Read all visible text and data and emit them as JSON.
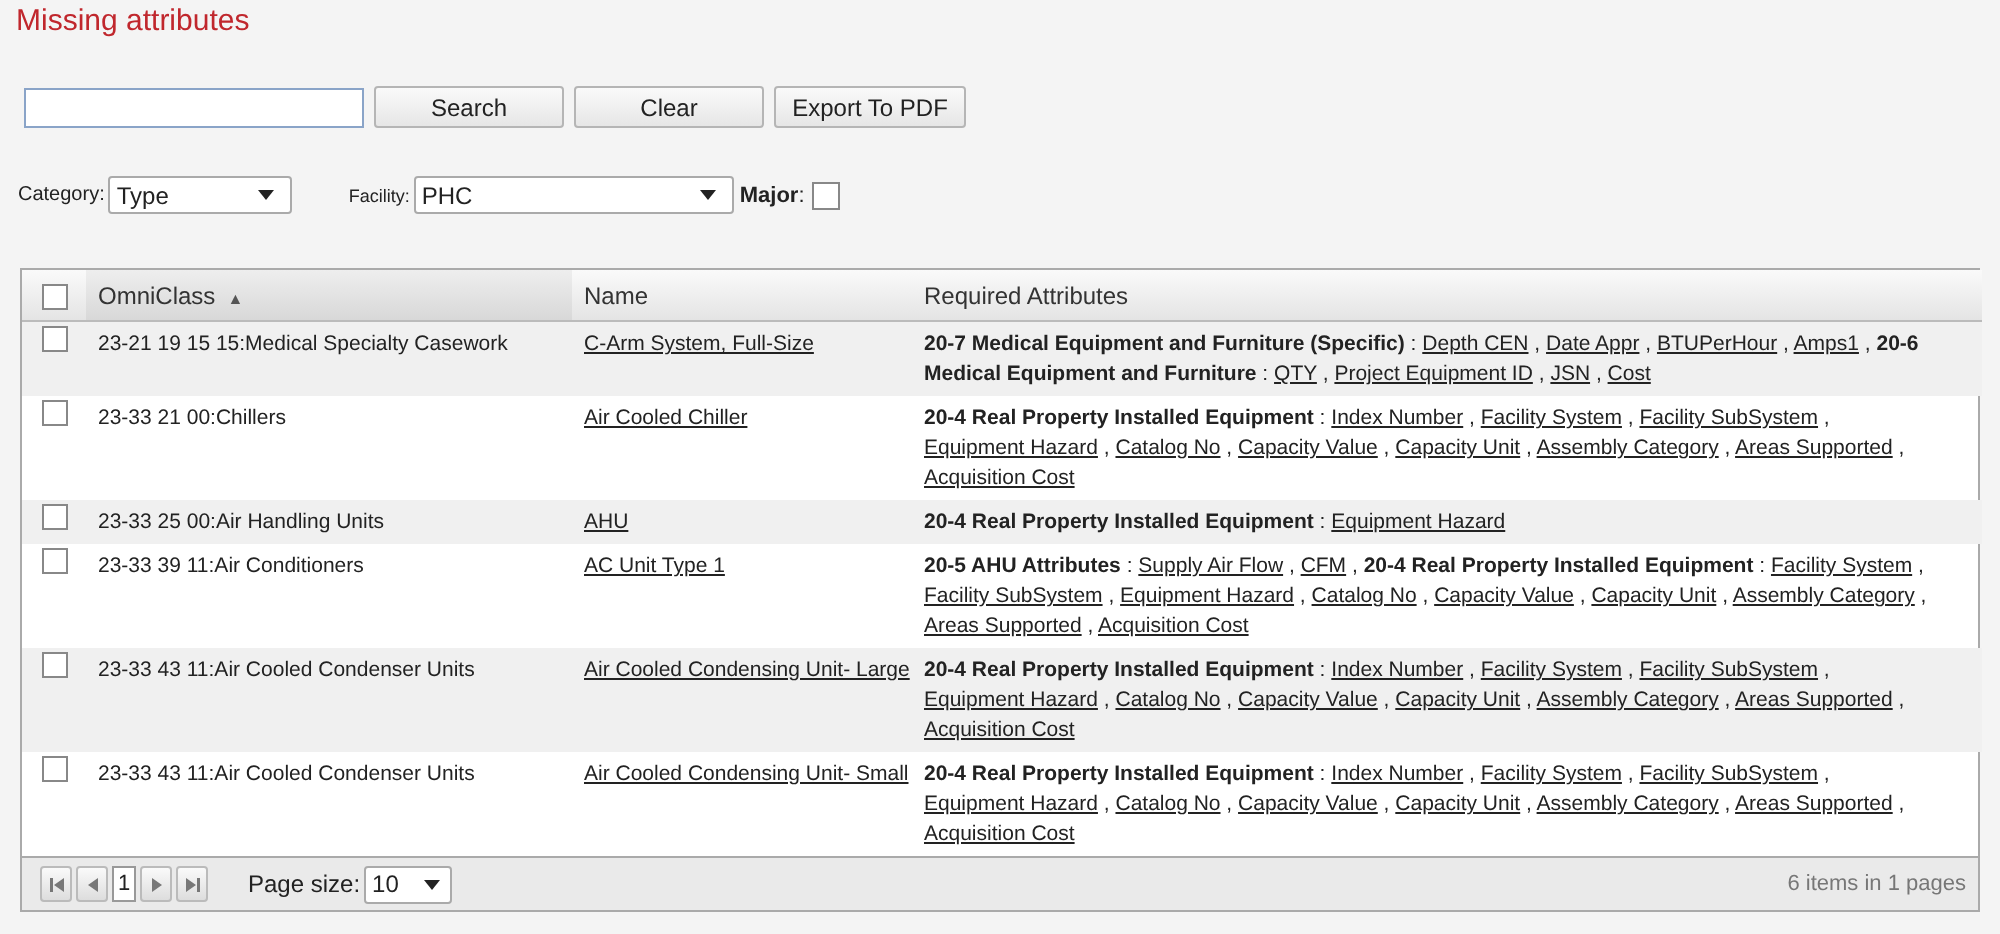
{
  "title": "Missing attributes",
  "buttons": [
    "Search",
    "Clear",
    "Export To PDF"
  ],
  "filters": {
    "category": {
      "label": "Category:",
      "value": "Type"
    },
    "facility": {
      "label": "Facility:",
      "value": "PHC"
    },
    "major": {
      "label": "Major",
      "colon": ":",
      "checked": false
    }
  },
  "table": {
    "header_checked": false,
    "group_colon": ":",
    "separator": ",",
    "columns": [
      {
        "label": "OmniClass",
        "sort": "▲"
      },
      {
        "label": "Name"
      },
      {
        "label": "Required Attributes"
      }
    ],
    "rows": [
      {
        "checked": false,
        "omniclass": "23-21 19 15 15:Medical Specialty Casework",
        "name": "C-Arm System, Full-Size",
        "attributes": [
          {
            "group": "20-7 Medical Equipment and Furniture (Specific)",
            "items": [
              "Depth CEN",
              "Date Appr",
              "BTUPerHour",
              "Amps1"
            ]
          },
          {
            "group": "20-6 Medical Equipment and Furniture",
            "items": [
              "QTY",
              "Project Equipment ID",
              "JSN",
              "Cost"
            ]
          }
        ]
      },
      {
        "checked": false,
        "omniclass": "23-33 21 00:Chillers",
        "name": "Air Cooled Chiller",
        "attributes": [
          {
            "group": "20-4 Real Property Installed Equipment",
            "items": [
              "Index Number",
              "Facility System",
              "Facility SubSystem",
              "Equipment Hazard",
              "Catalog No",
              "Capacity Value",
              "Capacity Unit",
              "Assembly Category",
              "Areas Supported",
              "Acquisition Cost"
            ]
          }
        ]
      },
      {
        "checked": false,
        "omniclass": "23-33 25 00:Air Handling Units",
        "name": "AHU",
        "attributes": [
          {
            "group": "20-4 Real Property Installed Equipment",
            "items": [
              "Equipment Hazard"
            ]
          }
        ]
      },
      {
        "checked": false,
        "omniclass": "23-33 39 11:Air Conditioners",
        "name": "AC Unit Type 1",
        "attributes": [
          {
            "group": "20-5 AHU Attributes",
            "items": [
              "Supply Air Flow",
              "CFM"
            ]
          },
          {
            "group": "20-4 Real Property Installed Equipment",
            "items": [
              "Facility System",
              "Facility SubSystem",
              "Equipment Hazard",
              "Catalog No",
              "Capacity Value",
              "Capacity Unit",
              "Assembly Category",
              "Areas Supported",
              "Acquisition Cost"
            ]
          }
        ]
      },
      {
        "checked": false,
        "omniclass": "23-33 43 11:Air Cooled Condenser Units",
        "name": "Air Cooled Condensing Unit- Large",
        "attributes": [
          {
            "group": "20-4 Real Property Installed Equipment",
            "items": [
              "Index Number",
              "Facility System",
              "Facility SubSystem",
              "Equipment Hazard",
              "Catalog No",
              "Capacity Value",
              "Capacity Unit",
              "Assembly Category",
              "Areas Supported",
              "Acquisition Cost"
            ]
          }
        ]
      },
      {
        "checked": false,
        "omniclass": "23-33 43 11:Air Cooled Condenser Units",
        "name": "Air Cooled Condensing Unit- Small",
        "attributes": [
          {
            "group": "20-4 Real Property Installed Equipment",
            "items": [
              "Index Number",
              "Facility System",
              "Facility SubSystem",
              "Equipment Hazard",
              "Catalog No",
              "Capacity Value",
              "Capacity Unit",
              "Assembly Category",
              "Areas Supported",
              "Acquisition Cost"
            ]
          }
        ]
      }
    ]
  },
  "pager": {
    "page": "1",
    "page_size_label": "Page size:",
    "page_size": "10",
    "summary": "6 items in 1 pages"
  }
}
